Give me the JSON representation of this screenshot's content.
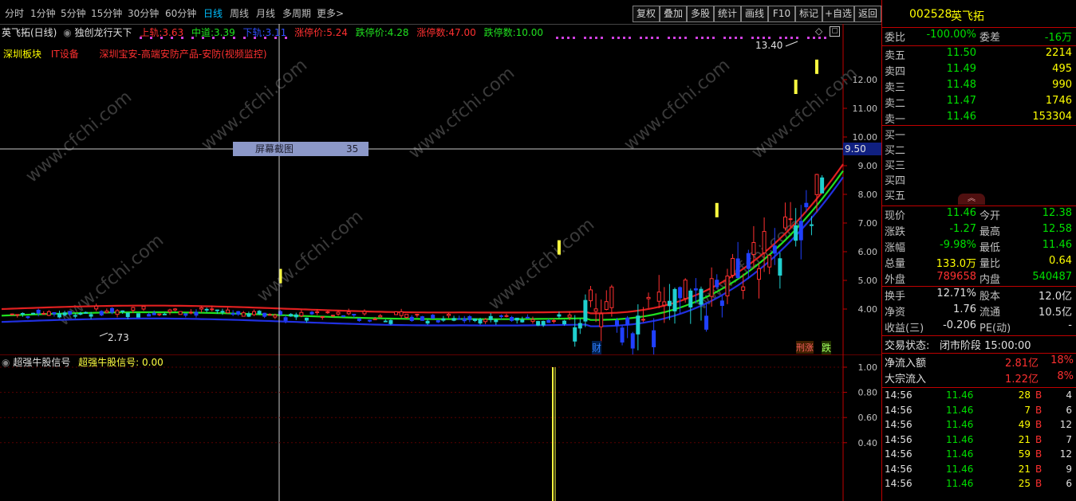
{
  "toolbar": {
    "periods": [
      "分时",
      "1分钟",
      "5分钟",
      "15分钟",
      "30分钟",
      "60分钟",
      "日线",
      "周线",
      "月线",
      "多周期",
      "更多>"
    ],
    "active_period": "日线",
    "buttons": [
      "复权",
      "叠加",
      "多股",
      "统计",
      "画线",
      "F10",
      "标记",
      "+自选",
      "返回"
    ]
  },
  "chart": {
    "title": "英飞拓(日线)",
    "indicator_name": "独创龙行天下",
    "upper_label": "上轨:",
    "upper_value": "3.63",
    "mid_label": "中道:",
    "mid_value": "3.39",
    "lower_label": "下轨:",
    "lower_value": "3.11",
    "limit_up_price_label": "涨停价:",
    "limit_up_price": "5.24",
    "limit_down_price_label": "跌停价:",
    "limit_down_price": "4.28",
    "limit_up_count_label": "涨停数:",
    "limit_up_count": "47.00",
    "limit_down_count_label": "跌停数:",
    "limit_down_count": "10.00",
    "sector_board": "深圳板块",
    "sector_industry": "IT设备",
    "sector_concept": "深圳宝安-高端安防产品-安防(视频监控)",
    "crosshair_label": "屏幕截图",
    "crosshair_value": "35",
    "crosshair_price": "9.50",
    "high_annotation": "13.40",
    "low_annotation": "2.73",
    "marker_cai": "财",
    "marker_xingzhang": "刑涨",
    "marker_die": "跌",
    "y_ticks": [
      "12.00",
      "11.00",
      "10.00",
      "9.00",
      "8.00",
      "7.00",
      "6.00",
      "5.00",
      "4.00"
    ],
    "watermark": "www.cfchi.com"
  },
  "indicator": {
    "name": "超强牛股信号",
    "value_label": "超强牛股信号:",
    "value": "0.00",
    "y_ticks": [
      "1.00",
      "0.80",
      "0.60",
      "0.40"
    ]
  },
  "quote": {
    "code": "002528",
    "name": "英飞拓",
    "weibi_label": "委比",
    "weibi_value": "-100.00%",
    "weicha_label": "委差",
    "weicha_value": "-16万",
    "asks": [
      {
        "label": "卖五",
        "price": "11.50",
        "vol": "2214"
      },
      {
        "label": "卖四",
        "price": "11.49",
        "vol": "495"
      },
      {
        "label": "卖三",
        "price": "11.48",
        "vol": "990"
      },
      {
        "label": "卖二",
        "price": "11.47",
        "vol": "1746"
      },
      {
        "label": "卖一",
        "price": "11.46",
        "vol": "153304"
      }
    ],
    "bids": [
      {
        "label": "买一"
      },
      {
        "label": "买二"
      },
      {
        "label": "买三"
      },
      {
        "label": "买四"
      },
      {
        "label": "买五"
      }
    ],
    "stats": [
      {
        "l1": "现价",
        "v1": "11.46",
        "c1": "green",
        "l2": "今开",
        "v2": "12.38",
        "c2": "green"
      },
      {
        "l1": "涨跌",
        "v1": "-1.27",
        "c1": "green",
        "l2": "最高",
        "v2": "12.58",
        "c2": "green"
      },
      {
        "l1": "涨幅",
        "v1": "-9.98%",
        "c1": "green",
        "l2": "最低",
        "v2": "11.46",
        "c2": "green"
      },
      {
        "l1": "总量",
        "v1": "133.0万",
        "c1": "yellow",
        "l2": "量比",
        "v2": "0.64",
        "c2": "yellow"
      },
      {
        "l1": "外盘",
        "v1": "789658",
        "c1": "red",
        "l2": "内盘",
        "v2": "540487",
        "c2": "green"
      }
    ],
    "fund": [
      {
        "l1": "换手",
        "v1": "12.71%",
        "l2": "股本",
        "v2": "12.0亿"
      },
      {
        "l1": "净资",
        "v1": "1.76",
        "l2": "流通",
        "v2": "10.5亿"
      },
      {
        "l1": "收益(三)",
        "v1": "-0.206",
        "l2": "PE(动)",
        "v2": "-"
      }
    ],
    "trade_status_label": "交易状态:",
    "trade_status": "闭市阶段 15:00:00",
    "net_inflow_label": "净流入额",
    "net_inflow_value": "2.81亿",
    "net_inflow_pct": "18%",
    "block_inflow_label": "大宗流入",
    "block_inflow_value": "1.22亿",
    "block_inflow_pct": "8%",
    "ticks": [
      {
        "time": "14:56",
        "price": "11.46",
        "vol": "28",
        "side": "B",
        "n": "4"
      },
      {
        "time": "14:56",
        "price": "11.46",
        "vol": "7",
        "side": "B",
        "n": "6"
      },
      {
        "time": "14:56",
        "price": "11.46",
        "vol": "49",
        "side": "B",
        "n": "12"
      },
      {
        "time": "14:56",
        "price": "11.46",
        "vol": "21",
        "side": "B",
        "n": "7"
      },
      {
        "time": "14:56",
        "price": "11.46",
        "vol": "59",
        "side": "B",
        "n": "12"
      },
      {
        "time": "14:56",
        "price": "11.46",
        "vol": "21",
        "side": "B",
        "n": "9"
      },
      {
        "time": "14:56",
        "price": "11.46",
        "vol": "25",
        "side": "B",
        "n": "6"
      }
    ]
  },
  "colors": {
    "upper_band": "#e02020",
    "middle_band": "#20e020",
    "lower_band": "#2030e0",
    "up_candle": "#ff3030",
    "down_candle": "#20d0d0",
    "accent_blue": "#00c0ff",
    "signal": "#ffff40"
  }
}
